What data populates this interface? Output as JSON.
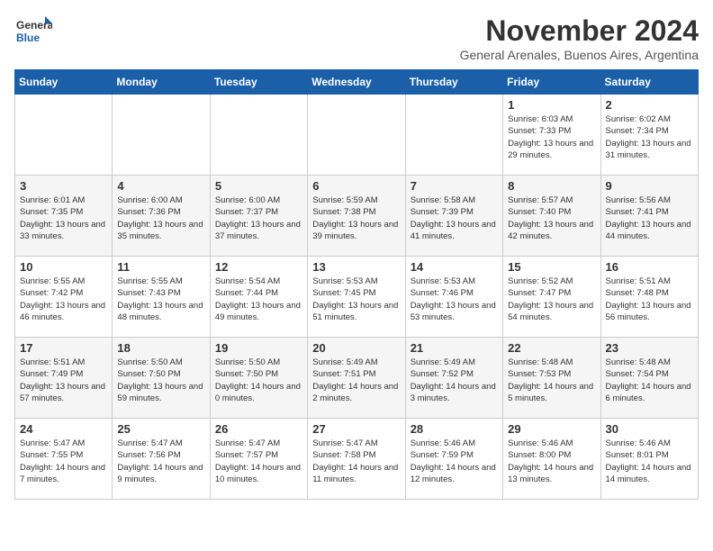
{
  "header": {
    "logo_general": "General",
    "logo_blue": "Blue",
    "month_title": "November 2024",
    "subtitle": "General Arenales, Buenos Aires, Argentina"
  },
  "weekdays": [
    "Sunday",
    "Monday",
    "Tuesday",
    "Wednesday",
    "Thursday",
    "Friday",
    "Saturday"
  ],
  "weeks": [
    [
      {
        "day": "",
        "info": ""
      },
      {
        "day": "",
        "info": ""
      },
      {
        "day": "",
        "info": ""
      },
      {
        "day": "",
        "info": ""
      },
      {
        "day": "",
        "info": ""
      },
      {
        "day": "1",
        "info": "Sunrise: 6:03 AM\nSunset: 7:33 PM\nDaylight: 13 hours and 29 minutes."
      },
      {
        "day": "2",
        "info": "Sunrise: 6:02 AM\nSunset: 7:34 PM\nDaylight: 13 hours and 31 minutes."
      }
    ],
    [
      {
        "day": "3",
        "info": "Sunrise: 6:01 AM\nSunset: 7:35 PM\nDaylight: 13 hours and 33 minutes."
      },
      {
        "day": "4",
        "info": "Sunrise: 6:00 AM\nSunset: 7:36 PM\nDaylight: 13 hours and 35 minutes."
      },
      {
        "day": "5",
        "info": "Sunrise: 6:00 AM\nSunset: 7:37 PM\nDaylight: 13 hours and 37 minutes."
      },
      {
        "day": "6",
        "info": "Sunrise: 5:59 AM\nSunset: 7:38 PM\nDaylight: 13 hours and 39 minutes."
      },
      {
        "day": "7",
        "info": "Sunrise: 5:58 AM\nSunset: 7:39 PM\nDaylight: 13 hours and 41 minutes."
      },
      {
        "day": "8",
        "info": "Sunrise: 5:57 AM\nSunset: 7:40 PM\nDaylight: 13 hours and 42 minutes."
      },
      {
        "day": "9",
        "info": "Sunrise: 5:56 AM\nSunset: 7:41 PM\nDaylight: 13 hours and 44 minutes."
      }
    ],
    [
      {
        "day": "10",
        "info": "Sunrise: 5:55 AM\nSunset: 7:42 PM\nDaylight: 13 hours and 46 minutes."
      },
      {
        "day": "11",
        "info": "Sunrise: 5:55 AM\nSunset: 7:43 PM\nDaylight: 13 hours and 48 minutes."
      },
      {
        "day": "12",
        "info": "Sunrise: 5:54 AM\nSunset: 7:44 PM\nDaylight: 13 hours and 49 minutes."
      },
      {
        "day": "13",
        "info": "Sunrise: 5:53 AM\nSunset: 7:45 PM\nDaylight: 13 hours and 51 minutes."
      },
      {
        "day": "14",
        "info": "Sunrise: 5:53 AM\nSunset: 7:46 PM\nDaylight: 13 hours and 53 minutes."
      },
      {
        "day": "15",
        "info": "Sunrise: 5:52 AM\nSunset: 7:47 PM\nDaylight: 13 hours and 54 minutes."
      },
      {
        "day": "16",
        "info": "Sunrise: 5:51 AM\nSunset: 7:48 PM\nDaylight: 13 hours and 56 minutes."
      }
    ],
    [
      {
        "day": "17",
        "info": "Sunrise: 5:51 AM\nSunset: 7:49 PM\nDaylight: 13 hours and 57 minutes."
      },
      {
        "day": "18",
        "info": "Sunrise: 5:50 AM\nSunset: 7:50 PM\nDaylight: 13 hours and 59 minutes."
      },
      {
        "day": "19",
        "info": "Sunrise: 5:50 AM\nSunset: 7:50 PM\nDaylight: 14 hours and 0 minutes."
      },
      {
        "day": "20",
        "info": "Sunrise: 5:49 AM\nSunset: 7:51 PM\nDaylight: 14 hours and 2 minutes."
      },
      {
        "day": "21",
        "info": "Sunrise: 5:49 AM\nSunset: 7:52 PM\nDaylight: 14 hours and 3 minutes."
      },
      {
        "day": "22",
        "info": "Sunrise: 5:48 AM\nSunset: 7:53 PM\nDaylight: 14 hours and 5 minutes."
      },
      {
        "day": "23",
        "info": "Sunrise: 5:48 AM\nSunset: 7:54 PM\nDaylight: 14 hours and 6 minutes."
      }
    ],
    [
      {
        "day": "24",
        "info": "Sunrise: 5:47 AM\nSunset: 7:55 PM\nDaylight: 14 hours and 7 minutes."
      },
      {
        "day": "25",
        "info": "Sunrise: 5:47 AM\nSunset: 7:56 PM\nDaylight: 14 hours and 9 minutes."
      },
      {
        "day": "26",
        "info": "Sunrise: 5:47 AM\nSunset: 7:57 PM\nDaylight: 14 hours and 10 minutes."
      },
      {
        "day": "27",
        "info": "Sunrise: 5:47 AM\nSunset: 7:58 PM\nDaylight: 14 hours and 11 minutes."
      },
      {
        "day": "28",
        "info": "Sunrise: 5:46 AM\nSunset: 7:59 PM\nDaylight: 14 hours and 12 minutes."
      },
      {
        "day": "29",
        "info": "Sunrise: 5:46 AM\nSunset: 8:00 PM\nDaylight: 14 hours and 13 minutes."
      },
      {
        "day": "30",
        "info": "Sunrise: 5:46 AM\nSunset: 8:01 PM\nDaylight: 14 hours and 14 minutes."
      }
    ]
  ]
}
